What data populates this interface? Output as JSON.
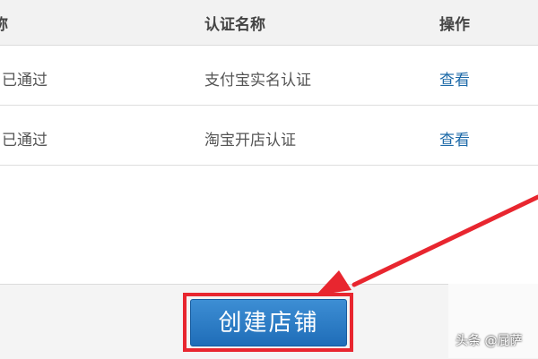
{
  "table": {
    "headers": [
      "称",
      "认证名称",
      "操作"
    ],
    "rows": [
      {
        "status": "已通过",
        "name": "支付宝实名认证",
        "action": "查看"
      },
      {
        "status": "已通过",
        "name": "淘宝开店认证",
        "action": "查看"
      }
    ]
  },
  "footer": {
    "create_label": "创建店铺"
  },
  "watermark": {
    "text": "头条 @屁萨"
  },
  "colors": {
    "link": "#1e6aa8",
    "button": "#2a7cc7",
    "highlight": "#e8262f"
  }
}
